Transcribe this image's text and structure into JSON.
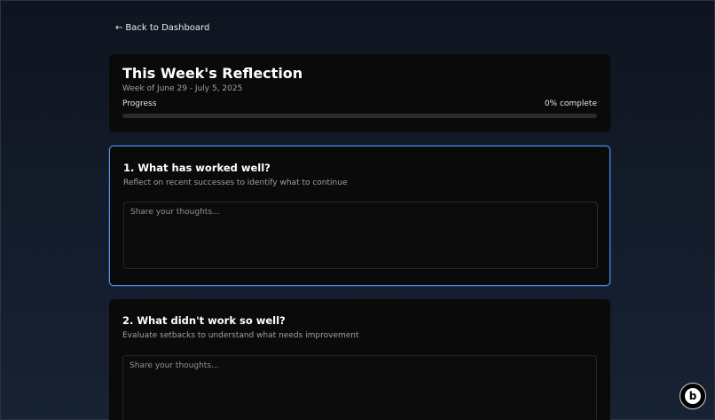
{
  "nav": {
    "back_arrow": "←",
    "back_label": "Back to Dashboard"
  },
  "header": {
    "title": "This Week's Reflection",
    "subtitle": "Week of June 29 - July 5, 2025",
    "progress_label": "Progress",
    "progress_text": "0% complete",
    "progress_fraction": 0
  },
  "questions": [
    {
      "title": "1. What has worked well?",
      "description": "Reflect on recent successes to identify what to continue",
      "placeholder": "Share your thoughts...",
      "value": ""
    },
    {
      "title": "2. What didn't work so well?",
      "description": "Evaluate setbacks to understand what needs improvement",
      "placeholder": "Share your thoughts...",
      "value": ""
    }
  ],
  "badge": {
    "icon": "bolt-b-logo-icon",
    "letter": "b"
  },
  "colors": {
    "background": "#141c2b",
    "card": "#0a0a0a",
    "accent": "#4a8ff0",
    "muted_text": "#9aa0a8"
  }
}
